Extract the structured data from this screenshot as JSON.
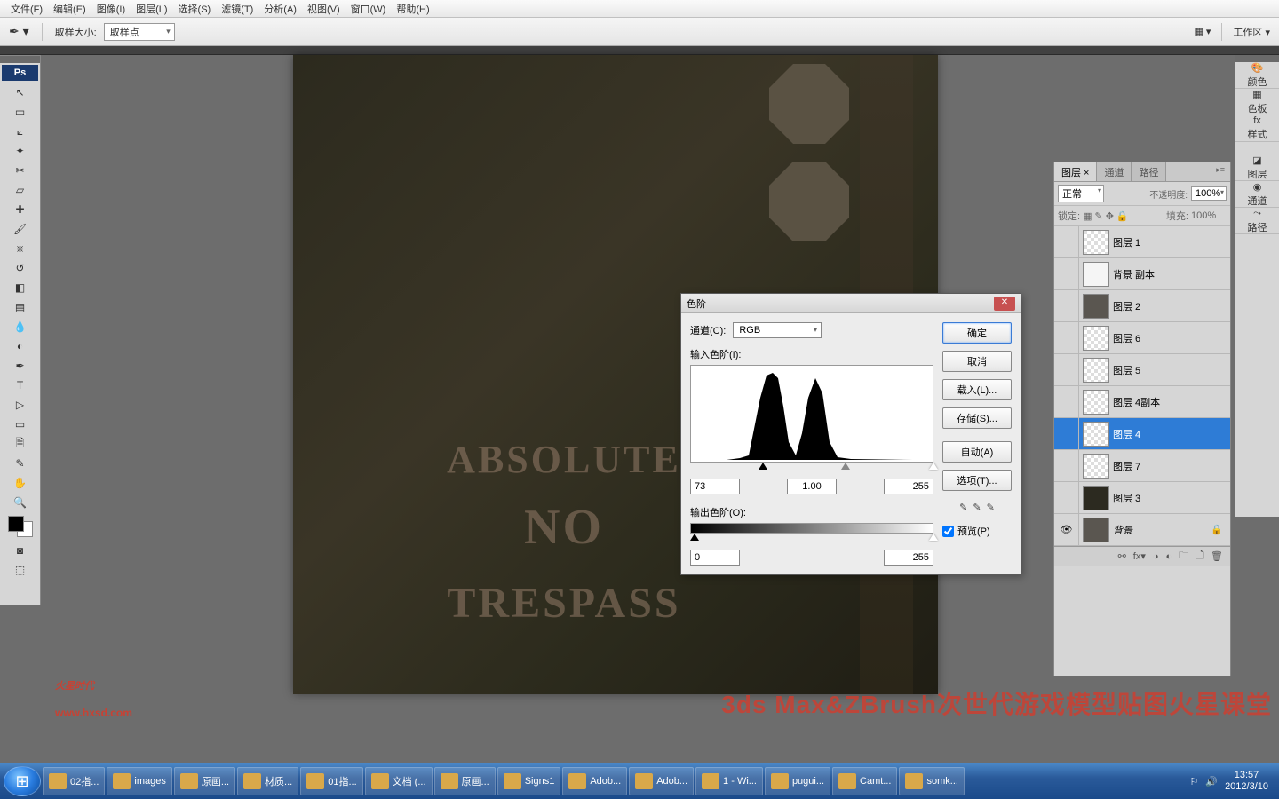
{
  "menu": {
    "file": "文件(F)",
    "edit": "编辑(E)",
    "image": "图像(I)",
    "layer": "图层(L)",
    "select": "选择(S)",
    "filter": "滤镜(T)",
    "analysis": "分析(A)",
    "view": "视图(V)",
    "window": "窗口(W)",
    "help": "帮助(H)"
  },
  "options": {
    "sample_label": "取样大小:",
    "sample_value": "取样点",
    "workspace_label": "工作区 ▾"
  },
  "right_panels": [
    "颜色",
    "色板",
    "样式",
    "图层",
    "通道",
    "路径"
  ],
  "layers_panel": {
    "tabs": [
      "图层 ×",
      "通道",
      "路径"
    ],
    "blend": "正常",
    "opacity_label": "不透明度:",
    "opacity": "100%",
    "lock_label": "锁定:",
    "fill_label": "填充:",
    "fill": "100%",
    "items": [
      {
        "name": "图层 1",
        "vis": false,
        "thumb": "checker"
      },
      {
        "name": "背景 副本",
        "vis": false,
        "thumb": "white"
      },
      {
        "name": "图层 2",
        "vis": false,
        "thumb": "gray"
      },
      {
        "name": "图层 6",
        "vis": false,
        "thumb": "checker"
      },
      {
        "name": "图层 5",
        "vis": false,
        "thumb": "checker"
      },
      {
        "name": "图层 4副本",
        "vis": false,
        "thumb": "checker"
      },
      {
        "name": "图层 4",
        "vis": false,
        "thumb": "checker",
        "selected": true
      },
      {
        "name": "图层 7",
        "vis": false,
        "thumb": "checker"
      },
      {
        "name": "图层 3",
        "vis": false,
        "thumb": "dark"
      },
      {
        "name": "背景",
        "vis": true,
        "thumb": "gray",
        "locked": true,
        "italic": true
      }
    ]
  },
  "levels": {
    "title": "色阶",
    "channel_label": "通道(C):",
    "channel": "RGB",
    "input_label": "输入色阶(I):",
    "in_black": "73",
    "in_gamma": "1.00",
    "in_white": "255",
    "output_label": "输出色阶(O):",
    "out_black": "0",
    "out_white": "255",
    "btn_ok": "确定",
    "btn_cancel": "取消",
    "btn_load": "载入(L)...",
    "btn_save": "存储(S)...",
    "btn_auto": "自动(A)",
    "btn_options": "选项(T)...",
    "preview_label": "预览(P)",
    "preview_checked": true
  },
  "canvas_text": {
    "l1": "ABSOLUTE",
    "l2": "NO",
    "l3": "TRESPASS"
  },
  "watermarks": {
    "logo": "火星时代",
    "url": "www.hxsd.com",
    "banner": "3ds Max&ZBrush次世代游戏模型贴图火星课堂"
  },
  "taskbar": {
    "items": [
      "02指...",
      "images",
      "原画...",
      "材质...",
      "01指...",
      "文档 (...",
      "原画...",
      "Signs1",
      "Adob...",
      "Adob...",
      "1 - Wi...",
      "pugui...",
      "Camt...",
      "somk..."
    ],
    "time": "13:57",
    "date": "2012/3/10"
  }
}
